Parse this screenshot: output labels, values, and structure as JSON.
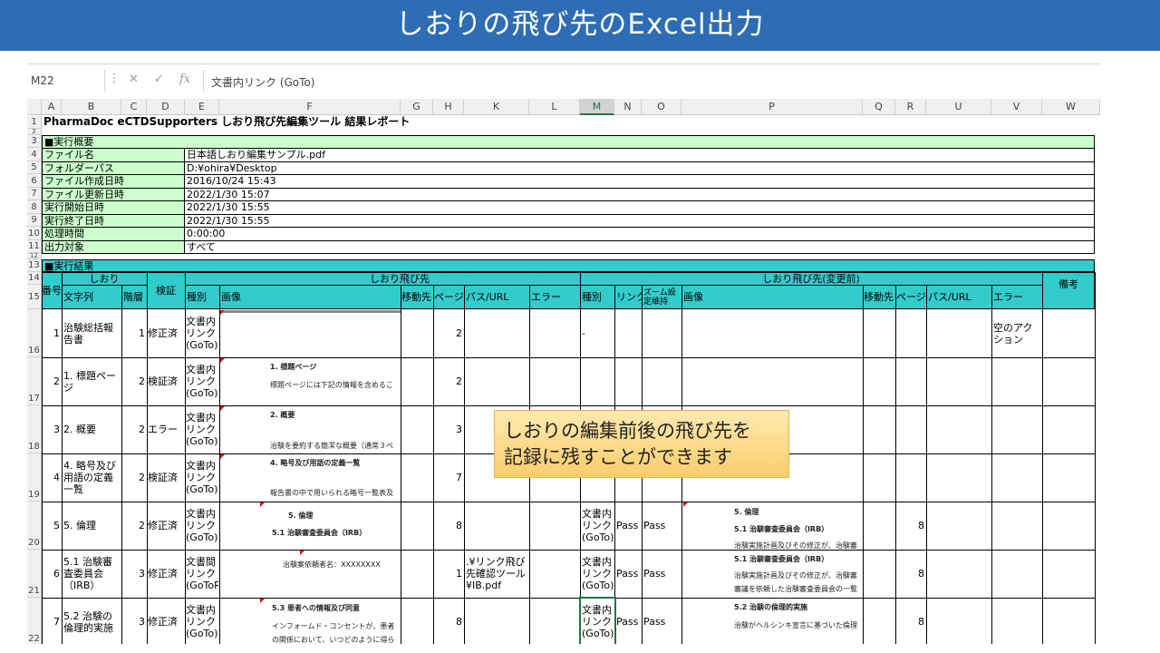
{
  "banner": {
    "title": "しおりの飛び先のExcel出力"
  },
  "formula_bar": {
    "name_box": "M22",
    "dots": "⋮",
    "cancel": "✕",
    "enter": "✓",
    "fx": "fx",
    "formula": "文書内リンク (GoTo)"
  },
  "columns": [
    "A",
    "B",
    "C",
    "D",
    "E",
    "F",
    "G",
    "H",
    "K",
    "L",
    "M",
    "N",
    "O",
    "P",
    "Q",
    "R",
    "U",
    "V",
    "W"
  ],
  "report": {
    "title": "PharmaDoc eCTDSupporters しおり飛び先編集ツール 結果レポート",
    "summary_heading": "■実行概要",
    "summary": [
      {
        "label": "ファイル名",
        "value": "日本語しおり編集サンプル.pdf"
      },
      {
        "label": "フォルダーパス",
        "value": "D:¥ohira¥Desktop"
      },
      {
        "label": "ファイル作成日時",
        "value": "2016/10/24 15:43"
      },
      {
        "label": "ファイル更新日時",
        "value": "2022/1/30 15:07"
      },
      {
        "label": "実行開始日時",
        "value": "2022/1/30 15:55"
      },
      {
        "label": "実行終了日時",
        "value": "2022/1/30 15:55"
      },
      {
        "label": "処理時間",
        "value": "0:00:00"
      },
      {
        "label": "出力対象",
        "value": "すべて"
      }
    ],
    "results_heading": "■実行結果",
    "headers": {
      "no": "番号",
      "bookmark": "しおり",
      "text": "文字列",
      "level": "階層",
      "verify": "検証",
      "dest": "しおり飛び先",
      "dest_before": "しおり飛び先(変更前)",
      "type": "種別",
      "image": "画像",
      "move": "移動先",
      "page": "ページ",
      "path": "パス/URL",
      "error": "エラー",
      "link": "リンク",
      "zoom": "ズーム設定維持",
      "note": "備考"
    },
    "rows": [
      {
        "no": "1",
        "text": "治験総括報告書",
        "level": "1",
        "verify": "修正済",
        "type": "文書内リンク(GoTo)",
        "img_title": "",
        "img_body": "",
        "page": "2",
        "path": "",
        "prev_type": "-",
        "prev_link": "",
        "prev_zoom": "",
        "prev_img_title": "",
        "prev_img_sub": "",
        "prev_img_body": "",
        "prev_page": "",
        "prev_error": "空のアクション"
      },
      {
        "no": "2",
        "text": "1. 標題ページ",
        "level": "2",
        "verify": "検証済",
        "type": "文書内リンク(GoTo)",
        "img_title": "1. 標題ページ",
        "img_body": "標題ページには下記の情報を含めるこ",
        "page": "2",
        "path": "",
        "prev_type": "",
        "prev_link": "",
        "prev_zoom": "",
        "prev_img_title": "",
        "prev_img_sub": "",
        "prev_img_body": "",
        "prev_page": "",
        "prev_error": ""
      },
      {
        "no": "3",
        "text": "2. 概要",
        "level": "2",
        "verify": "エラー",
        "type": "文書内リンク(GoTo)",
        "img_title": "2. 概要",
        "img_body": "治験を要約する簡潔な概要（通常３ペ",
        "page": "3",
        "path": "",
        "prev_type": "",
        "prev_link": "",
        "prev_zoom": "",
        "prev_img_title": "",
        "prev_img_sub": "",
        "prev_img_body": "",
        "prev_page": "",
        "prev_error": ""
      },
      {
        "no": "4",
        "text": "4. 略号及び用語の定義一覧",
        "level": "2",
        "verify": "検証済",
        "type": "文書内リンク(GoTo)",
        "img_title": "4. 略号及び用語の定義一覧",
        "img_body": "報告書の中で用いられる略号一覧表及",
        "page": "7",
        "path": "",
        "prev_type": "",
        "prev_link": "",
        "prev_zoom": "",
        "prev_img_title": "",
        "prev_img_sub": "",
        "prev_img_body": "",
        "prev_page": "",
        "prev_error": ""
      },
      {
        "no": "5",
        "text": "5. 倫理",
        "level": "2",
        "verify": "修正済",
        "type": "文書内リンク(GoTo)",
        "img_title": "5. 倫理",
        "img_sub": "5.1 治験審査委員会（IRB）",
        "img_body": "",
        "page": "8",
        "path": "",
        "prev_type": "文書内リンク(GoTo)",
        "prev_link": "Pass",
        "prev_zoom": "Pass",
        "prev_img_title": "5. 倫理",
        "prev_img_sub": "5.1 治験審査委員会（IRB）",
        "prev_img_body": "治験実施計画及びその修正が、治験審",
        "prev_page": "8",
        "prev_error": ""
      },
      {
        "no": "6",
        "text": "5.1 治験審査委員会（IRB）",
        "level": "3",
        "verify": "修正済",
        "type": "文書間リンク(GoToR)",
        "img_title": "",
        "img_body": "治験案依頼者名：XXXXXXXX",
        "page": "1",
        "path": ".¥リンク飛び先確認ツール¥IB.pdf",
        "prev_type": "文書内リンク(GoTo)",
        "prev_link": "Pass",
        "prev_zoom": "Pass",
        "prev_img_title": "5.1 治験審査委員会（IRB）",
        "prev_img_sub": "治験実施計画及びその修正が、治験審",
        "prev_img_body": "審議を依頼した治験審査委員会の一覧",
        "prev_page": "8",
        "prev_error": ""
      },
      {
        "no": "7",
        "text": "5.2 治験の倫理的実施",
        "level": "3",
        "verify": "修正済",
        "type": "文書内リンク(GoTo)",
        "img_title": "5.3 患者への情報及び同意",
        "img_sub": "インフォームド・コンセントが、患者",
        "img_body": "の関係において、いつどのように得ら",
        "page": "8",
        "path": "",
        "prev_type": "文書内リンク(GoTo)",
        "prev_link": "Pass",
        "prev_zoom": "Pass",
        "prev_img_title": "5.2 治験の倫理的実施",
        "prev_img_sub": "",
        "prev_img_body": "治験がヘルシンキ宣言に基づいた倫理",
        "prev_page": "8",
        "prev_error": ""
      }
    ]
  },
  "row_numbers": [
    "1",
    "2",
    "3",
    "4",
    "5",
    "6",
    "7",
    "8",
    "9",
    "10",
    "11",
    "12",
    "13",
    "14",
    "15",
    "16",
    "17",
    "18",
    "19",
    "20",
    "21",
    "22"
  ],
  "callout": {
    "line1": "しおりの編集前後の飛び先を",
    "line2": "記録に残すことができます"
  }
}
